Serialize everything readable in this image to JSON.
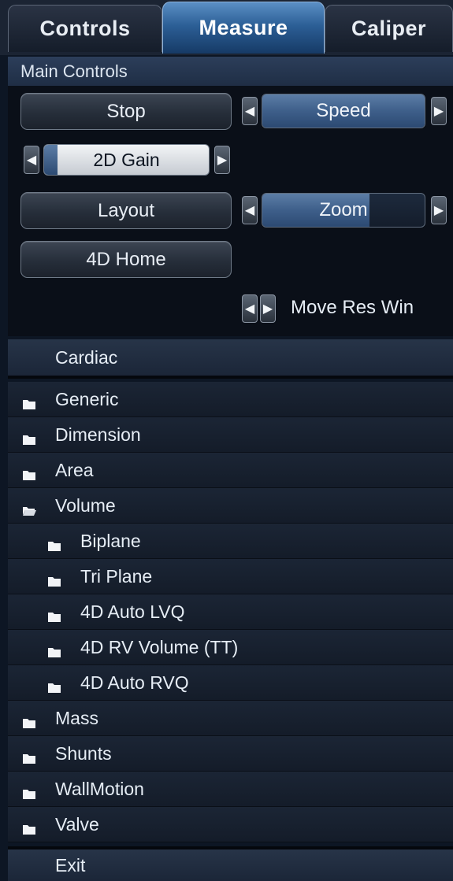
{
  "tabs": [
    "Controls",
    "Measure",
    "Caliper"
  ],
  "main_controls": {
    "header": "Main Controls",
    "stop_label": "Stop",
    "speed_label": "Speed",
    "speed_level": 1.0,
    "gain_label": "2D Gain",
    "gain_level": 0.08,
    "layout_label": "Layout",
    "zoom_label": "Zoom",
    "zoom_level": 0.66,
    "home_label": "4D Home",
    "move_res_label": "Move Res Win"
  },
  "measure_list": {
    "category": "Cardiac",
    "items": [
      {
        "label": "Generic",
        "icon": "folder-icon"
      },
      {
        "label": "Dimension",
        "icon": "folder-icon"
      },
      {
        "label": "Area",
        "icon": "folder-icon"
      },
      {
        "label": "Volume",
        "icon": "folder-open-icon"
      },
      {
        "label": "Biplane",
        "icon": "folder-icon"
      },
      {
        "label": "Tri Plane",
        "icon": "folder-icon"
      },
      {
        "label": "4D Auto LVQ",
        "icon": "folder-icon"
      },
      {
        "label": "4D RV Volume (TT)",
        "icon": "folder-icon"
      },
      {
        "label": "4D Auto RVQ",
        "icon": "folder-icon"
      },
      {
        "label": "Mass",
        "icon": "folder-icon"
      },
      {
        "label": "Shunts",
        "icon": "folder-icon"
      },
      {
        "label": "WallMotion",
        "icon": "folder-icon"
      },
      {
        "label": "Valve",
        "icon": "folder-icon"
      }
    ],
    "exit_label": "Exit"
  },
  "colors": {
    "accent": "#2c5f96",
    "background": "#0d1624",
    "text": "#e6edf5"
  }
}
